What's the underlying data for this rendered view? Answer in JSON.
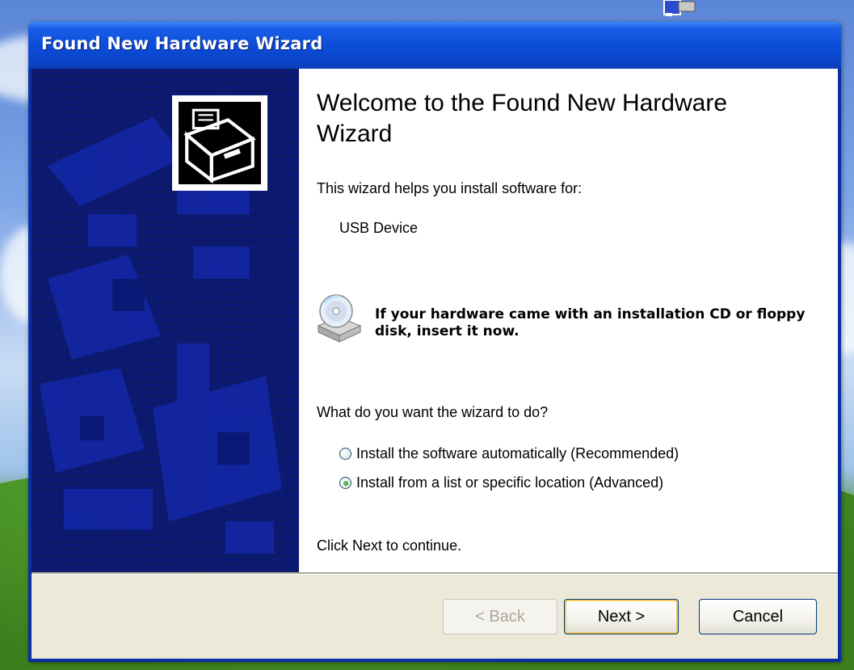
{
  "window": {
    "title": "Found New Hardware Wizard"
  },
  "content": {
    "heading": "Welcome to the Found New Hardware Wizard",
    "intro": "This wizard helps you install software for:",
    "device_name": "USB Device",
    "cd_prompt": "If your hardware came with an installation CD or floppy disk, insert it now.",
    "question": "What do you want the wizard to do?",
    "options": [
      {
        "label": "Install the software automatically (Recommended)",
        "selected": false
      },
      {
        "label": "Install from a list or specific location (Advanced)",
        "selected": true
      }
    ],
    "continue_text": "Click Next to continue."
  },
  "buttons": {
    "back": "< Back",
    "next": "Next >",
    "cancel": "Cancel"
  },
  "icons": {
    "hardware": "hardware-board-icon",
    "cd": "cd-drive-icon",
    "desktop": "desktop-shortcut-icon"
  },
  "colors": {
    "titlebar": "#0d4fd9",
    "left_panel": "#0d1a6b",
    "dialog_bg": "#ece9d8",
    "radio_selected": "#2d9e2d"
  }
}
